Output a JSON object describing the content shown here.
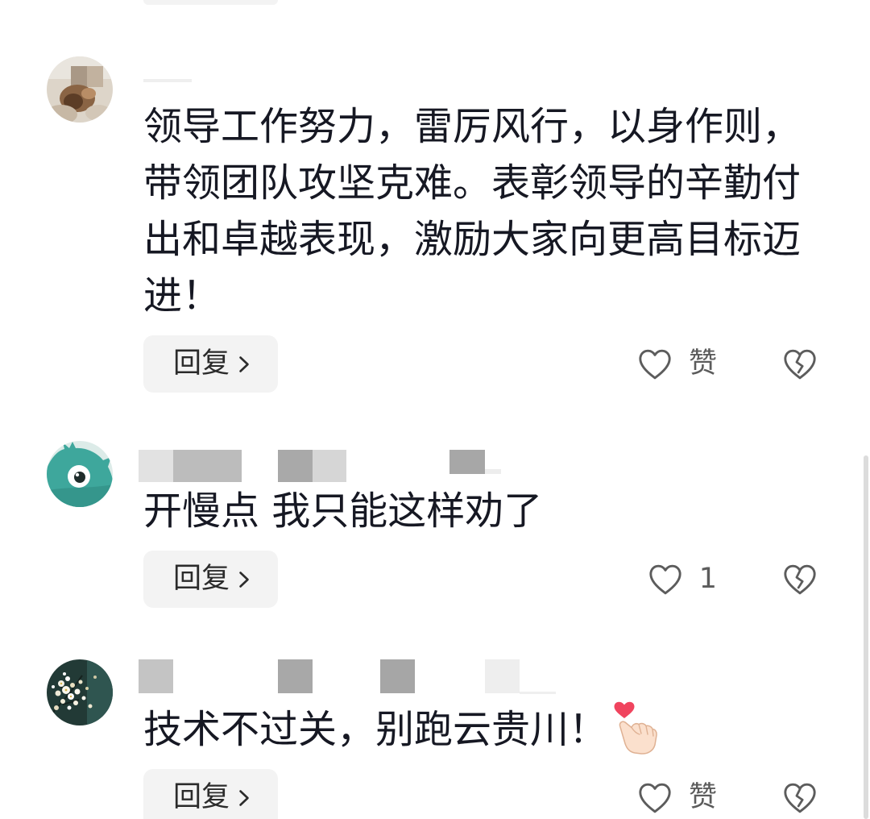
{
  "theme": {
    "background": "#ffffff",
    "comment_text": "#161823",
    "reply_button_bg": "#f3f3f3",
    "reply_button_text": "#2b2b2b",
    "icon": "#5c5c5c",
    "scrollbar": "#dcdcdc"
  },
  "comments": [
    {
      "text": "领导工作努力，雷厉风行，以身作则，带领团队攻坚克难。表彰领导的辛勤付出和卓越表现，激励大家向更高目标迈进！",
      "reply_label": "回复",
      "reply_icon": "chevron-right-icon",
      "like_label": "赞",
      "like_icon": "heart-outline-icon",
      "dislike_icon": "broken-heart-icon"
    },
    {
      "text": "开慢点 我只能这样劝了",
      "reply_label": "回复",
      "reply_icon": "chevron-right-icon",
      "like_label": "1",
      "like_icon": "heart-outline-icon",
      "dislike_icon": "broken-heart-icon"
    },
    {
      "text": "技术不过关，别跑云贵川！",
      "emoji": "finger-heart-emoji",
      "reply_label": "回复",
      "reply_icon": "chevron-right-icon",
      "like_label": "赞",
      "like_icon": "heart-outline-icon",
      "dislike_icon": "broken-heart-icon"
    }
  ]
}
